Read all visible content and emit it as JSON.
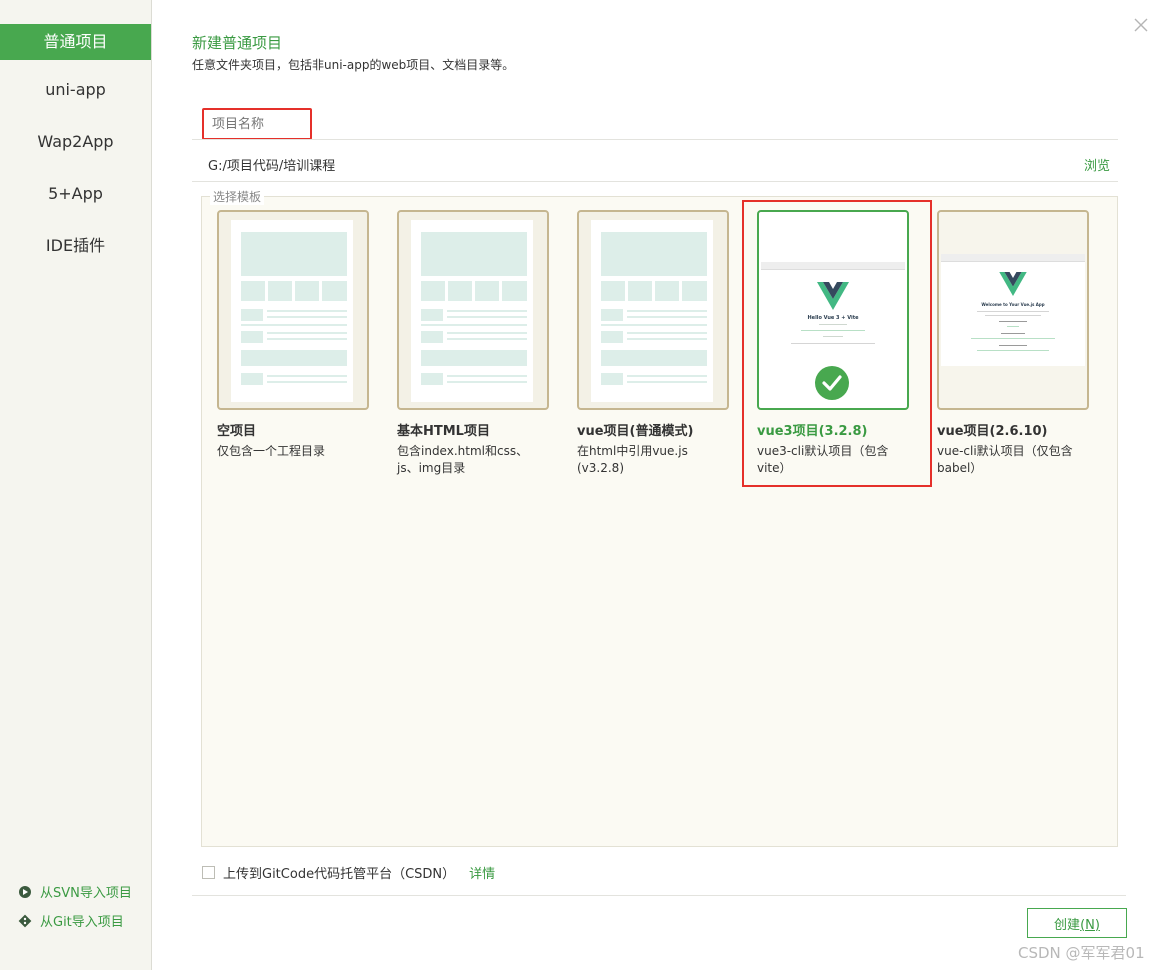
{
  "sidebar": {
    "items": [
      {
        "label": "普通项目",
        "active": true
      },
      {
        "label": "uni-app"
      },
      {
        "label": "Wap2App"
      },
      {
        "label": "5+App"
      },
      {
        "label": "IDE插件"
      }
    ],
    "import_svn": "从SVN导入项目",
    "import_git": "从Git导入项目"
  },
  "header": {
    "title": "新建普通项目",
    "subtitle": "任意文件夹项目，包括非uni-app的web项目、文档目录等。"
  },
  "form": {
    "name_placeholder": "项目名称",
    "path": "G:/项目代码/培训课程",
    "browse_label": "浏览"
  },
  "templates": {
    "legend": "选择模板",
    "selected_index": 3,
    "items": [
      {
        "title": "空项目",
        "desc": "仅包含一个工程目录"
      },
      {
        "title": "基本HTML项目",
        "desc": "包含index.html和css、js、img目录"
      },
      {
        "title": "vue项目(普通模式)",
        "desc": "在html中引用vue.js (v3.2.8)"
      },
      {
        "title": "vue3项目(3.2.8)",
        "desc": "vue3-cli默认项目（包含vite）",
        "preview_text": "Hello Vue 3 + Vite"
      },
      {
        "title": "vue项目(2.6.10)",
        "desc": "vue-cli默认项目（仅包含babel）",
        "preview_text": "Welcome to Your Vue.js App"
      }
    ]
  },
  "footer": {
    "gitcode_label": "上传到GitCode代码托管平台（CSDN）",
    "details_label": "详情",
    "create_label": "创建",
    "create_shortcut": "(N)"
  },
  "watermark": "CSDN @军军君01",
  "colors": {
    "accent": "#48a84f",
    "highlight_box": "#e5302a",
    "card_border": "#c5b690"
  }
}
